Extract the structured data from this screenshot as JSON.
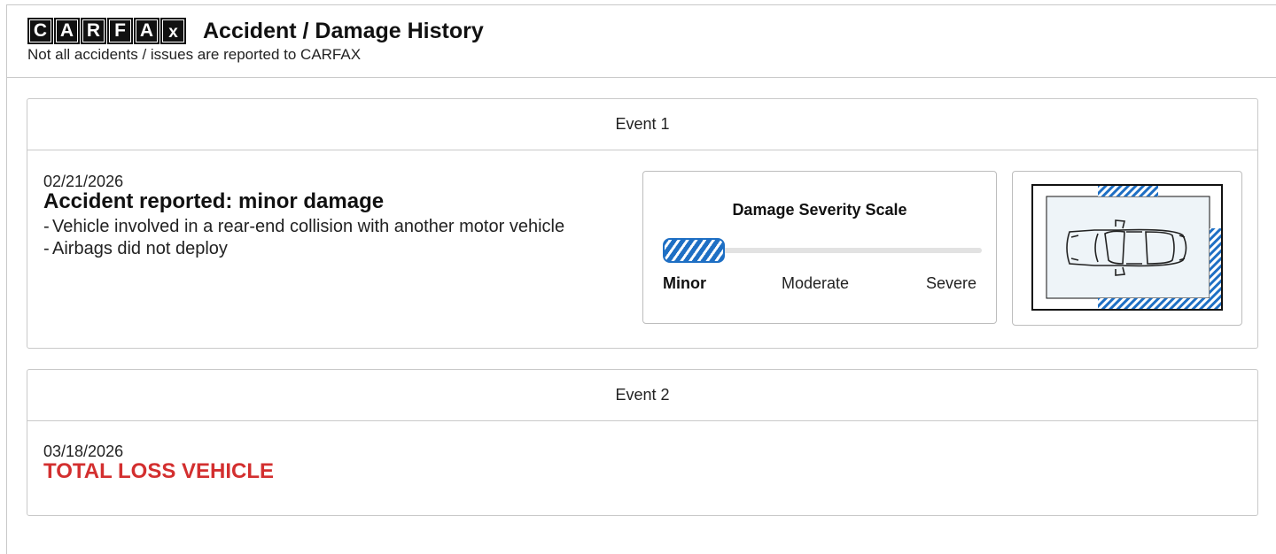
{
  "header": {
    "logo_letters": [
      "C",
      "A",
      "R",
      "F",
      "A",
      "x"
    ],
    "title": "Accident / Damage History",
    "subtitle": "Not all accidents / issues are reported to CARFAX"
  },
  "events": [
    {
      "label": "Event 1",
      "date": "02/21/2026",
      "title": "Accident reported: minor damage",
      "details": [
        "Vehicle involved in a rear-end collision with another motor vehicle",
        "Airbags did not deploy"
      ],
      "severity": {
        "title": "Damage Severity Scale",
        "levels": [
          "Minor",
          "Moderate",
          "Severe"
        ],
        "selected": "Minor",
        "level_fraction": 0.2
      },
      "damage_areas": [
        "front",
        "rear",
        "right-side"
      ]
    },
    {
      "label": "Event 2",
      "date": "03/18/2026",
      "title": "TOTAL LOSS VEHICLE"
    }
  ],
  "colors": {
    "accent": "#1e6fc4",
    "alert": "#d32f2f",
    "border": "#c9c9c9"
  },
  "icons": [
    "car-top-view-icon"
  ]
}
